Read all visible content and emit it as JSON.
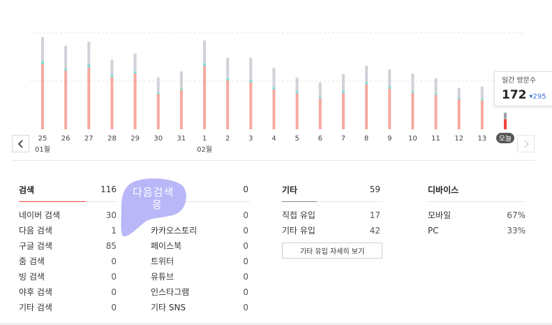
{
  "chart_data": {
    "type": "bar",
    "categories": [
      "25",
      "26",
      "27",
      "28",
      "29",
      "30",
      "31",
      "1",
      "2",
      "3",
      "4",
      "5",
      "6",
      "7",
      "8",
      "9",
      "10",
      "11",
      "12",
      "13",
      "오늘"
    ],
    "series": [
      {
        "values": [
          95,
          85,
          90,
          76,
          81,
          51,
          57,
          92,
          71,
          68,
          58,
          52,
          45,
          53,
          65,
          59,
          53,
          50,
          44,
          42,
          15
        ]
      },
      {
        "values": [
          4,
          3,
          4,
          3,
          3,
          2,
          2,
          4,
          3,
          3,
          3,
          3,
          2,
          3,
          3,
          3,
          2,
          2,
          2,
          2,
          1
        ]
      },
      {
        "values": [
          35,
          33,
          33,
          22,
          26,
          22,
          25,
          33,
          30,
          33,
          28,
          20,
          21,
          24,
          24,
          25,
          26,
          22,
          14,
          18,
          8
        ]
      }
    ],
    "colors": [
      "#f7a9a0",
      "#7cdcd4",
      "#cfd2d7"
    ],
    "today_color": "#f0443a",
    "ylim": [
      0,
      140
    ],
    "month_labels": [
      {
        "text": "01월",
        "index": 0
      },
      {
        "text": "02월",
        "index": 7
      }
    ],
    "selected_label_bg": "#555555"
  },
  "tooltip": {
    "label": "일간 방문수",
    "value": "172",
    "delta": "▾295"
  },
  "stats": {
    "search": {
      "label": "검색",
      "value": "116",
      "accent": "#f0443a",
      "rows": [
        {
          "label": "네이버 검색",
          "value": "30"
        },
        {
          "label": "다음 검색",
          "value": "1"
        },
        {
          "label": "구글 검색",
          "value": "85"
        },
        {
          "label": "줌 검색",
          "value": "0"
        },
        {
          "label": "빙 검색",
          "value": "0"
        },
        {
          "label": "야후 검색",
          "value": "0"
        },
        {
          "label": "기타 검색",
          "value": "0"
        }
      ]
    },
    "sns": {
      "label": "",
      "value": "0",
      "rows": [
        {
          "label": "",
          "value": "0"
        },
        {
          "label": "카카오스토리",
          "value": "0"
        },
        {
          "label": "페이스북",
          "value": "0"
        },
        {
          "label": "트위터",
          "value": "0"
        },
        {
          "label": "유튜브",
          "value": "0"
        },
        {
          "label": "인스타그램",
          "value": "0"
        },
        {
          "label": "기타 SNS",
          "value": "0"
        }
      ]
    },
    "etc": {
      "label": "기타",
      "value": "59",
      "accent": "#777777",
      "rows": [
        {
          "label": "직접 유입",
          "value": "17"
        },
        {
          "label": "기타 유입",
          "value": "42"
        }
      ],
      "more_button": "기타 유입 자세히 보기"
    },
    "device": {
      "label": "디바이스",
      "value": "",
      "rows": [
        {
          "label": "모바일",
          "value": "67%"
        },
        {
          "label": "PC",
          "value": "33%"
        }
      ]
    }
  },
  "overlay": {
    "text": "다음검색",
    "char": "응",
    "color": "#b9b7f7"
  }
}
